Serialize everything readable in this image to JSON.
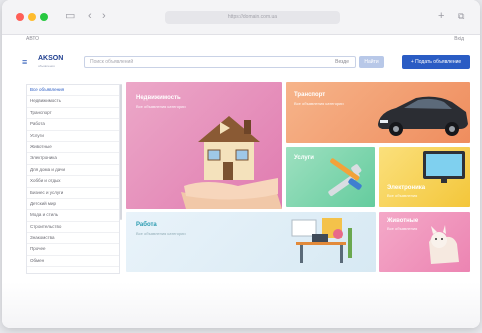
{
  "browser": {
    "url": "https://domain.com.ua",
    "top_left_link": "АВТО",
    "top_right_link": "Вхід"
  },
  "header": {
    "logo": "AKSON",
    "logo_sub": "объявления",
    "search_placeholder": "Поиск объявлений",
    "search_scope": "Везде",
    "search_button": "Найти",
    "post_button": "+ Подать объявление"
  },
  "sidebar": {
    "items": [
      "Все объявления",
      "Недвижимость",
      "Транспорт",
      "Работа",
      "Услуги",
      "Животные",
      "Электроника",
      "Для дома и дачи",
      "Хобби и отдых",
      "Бизнес и услуги",
      "Детский мир",
      "Мода и стиль",
      "Строительство",
      "Знакомства",
      "Прочее",
      "Обмен"
    ]
  },
  "tiles": {
    "real_estate": {
      "title": "Недвижимость",
      "subtitle": "Все объявления категории"
    },
    "transport": {
      "title": "Транспорт",
      "subtitle": "Все объявления категории"
    },
    "services": {
      "title": "Услуги",
      "subtitle": ""
    },
    "electronics": {
      "title": "Электроника",
      "subtitle": "Все объявления"
    },
    "job": {
      "title": "Работа",
      "subtitle": "Все объявления категории"
    },
    "pets": {
      "title": "Животные",
      "subtitle": "Все объявления"
    }
  },
  "colors": {
    "brand": "#2a5cc4",
    "real_estate": "#e07bb0",
    "transport": "#ef8d5e",
    "services": "#64cc9e",
    "electronics": "#f3c63a",
    "job": "#d7e9f3",
    "pets": "#ec84b2"
  }
}
